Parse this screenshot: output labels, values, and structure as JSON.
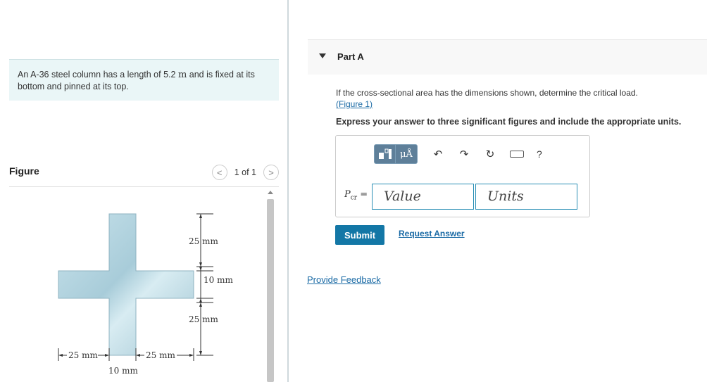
{
  "problem": {
    "text_before": "An A-36 steel column has a length of 5.2 ",
    "length_unit": "m",
    "text_after": " and is fixed at its bottom and pinned at its top."
  },
  "figure": {
    "title": "Figure",
    "pager_text": "1 of 1",
    "prev_label": "<",
    "next_label": ">",
    "dims": {
      "top_height": "25 mm",
      "middle_thickness": "10 mm",
      "bottom_height": "25 mm",
      "left_width": "25 mm",
      "right_width": "25 mm",
      "center_thickness": "10 mm"
    }
  },
  "part": {
    "title": "Part A",
    "question_text": "If the cross-sectional area has the dimensions shown, determine the critical load.",
    "figure_link": "(Figure 1)",
    "instruction": "Express your answer to three significant figures and include the appropriate units."
  },
  "answer": {
    "label_main": "P",
    "label_sub": "cr",
    "label_eq": " =",
    "value_placeholder": "Value",
    "units_placeholder": "Units",
    "toolbar": {
      "units_button_label": "μÅ",
      "undo_icon": "↶",
      "redo_icon": "↷",
      "reset_icon": "↻",
      "help_label": "?"
    }
  },
  "actions": {
    "submit_label": "Submit",
    "request_answer_label": "Request Answer",
    "feedback_label": "Provide Feedback"
  },
  "colors": {
    "accent": "#1377a6",
    "link": "#1a6aa5",
    "problem_bg": "#eaf6f7",
    "steel": "#b9d9e4"
  }
}
